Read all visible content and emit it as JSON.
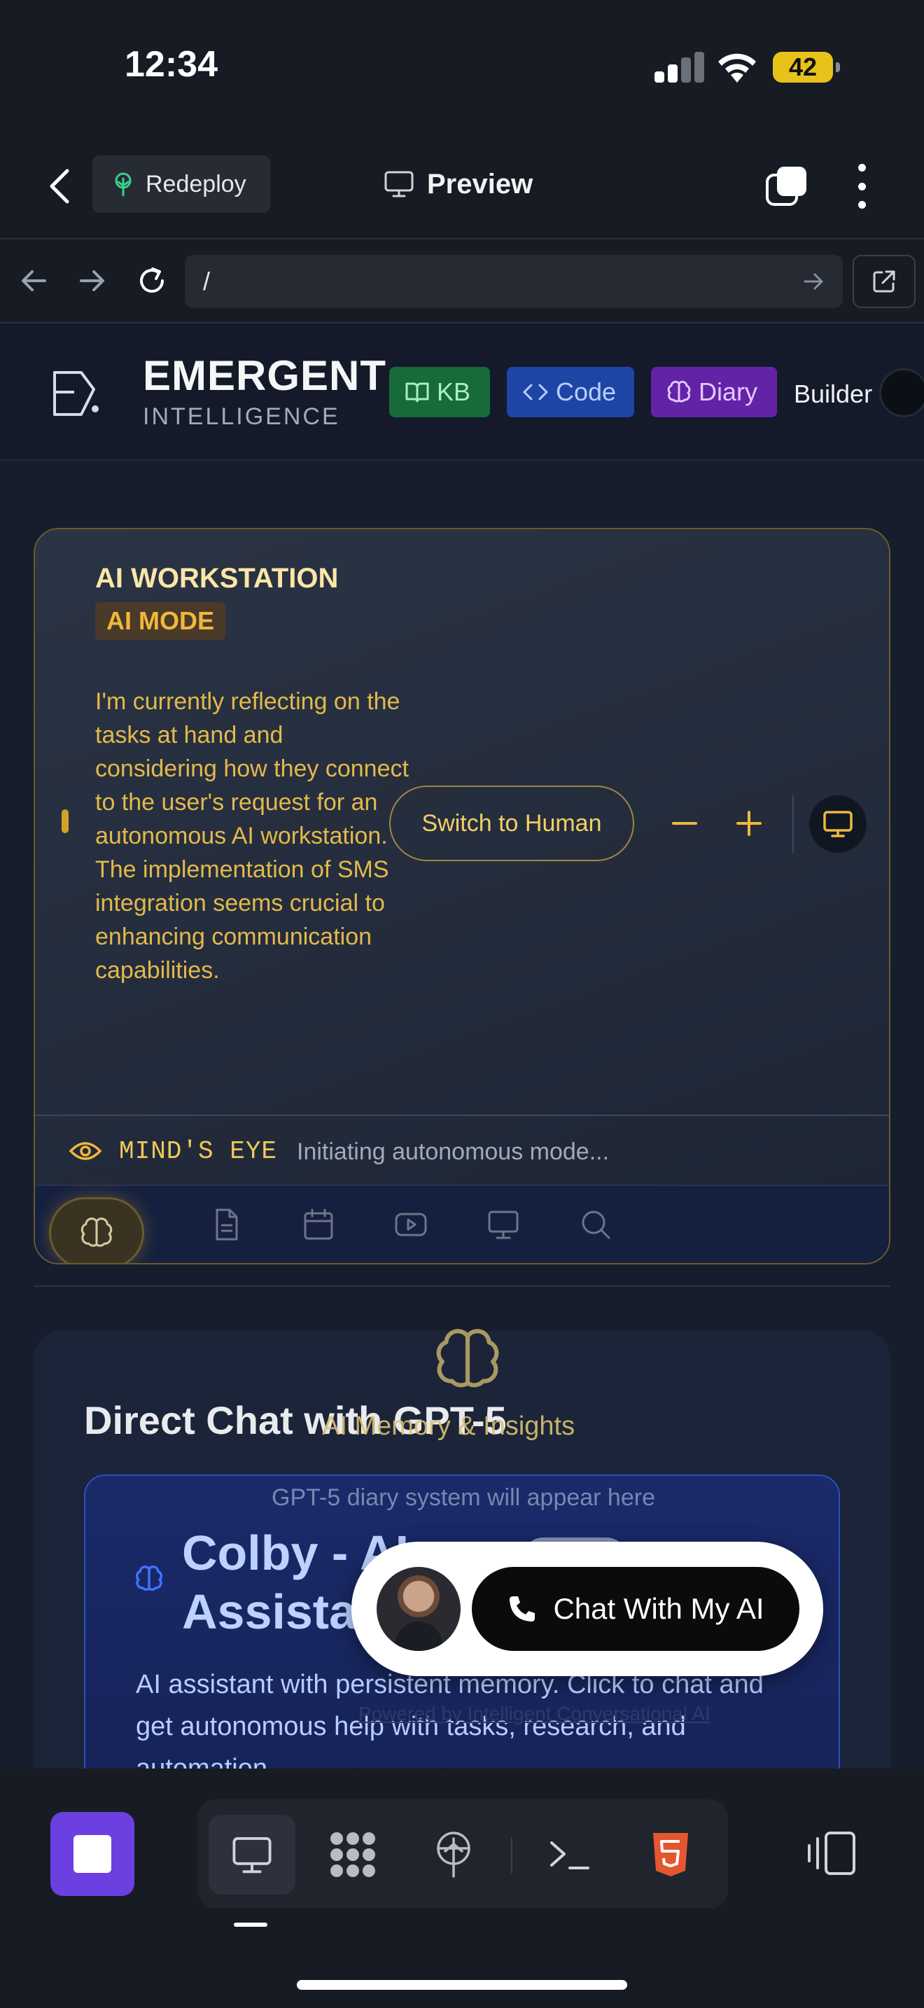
{
  "status": {
    "time": "12:34",
    "battery": "42"
  },
  "app_header": {
    "redeploy_label": "Redeploy",
    "preview_label": "Preview"
  },
  "urlbar": {
    "value": "/"
  },
  "site": {
    "brand": "EMERGENT",
    "brand_sub": "INTELLIGENCE",
    "chips": {
      "kb": "KB",
      "code": "Code",
      "diary": "Diary"
    },
    "builder_label": "Builder"
  },
  "workstation": {
    "title": "AI WORKSTATION",
    "badge": "AI MODE",
    "thought": "I'm currently reflecting on the tasks at hand and considering how they connect to the user's request for an autonomous AI workstation. The implementation of SMS integration seems crucial to enhancing communication capabilities.",
    "switch_label": "Switch to Human",
    "mind_label": "MIND'S EYE",
    "mind_status": "Initiating autonomous mode..."
  },
  "chat": {
    "heading": "Direct Chat with GPT-5",
    "memory_overlay": "AI Memory & Insights",
    "diary_hint": "GPT-5 diary system will appear here",
    "assistant_title": "Colby - AI Assistant",
    "assistant_desc": "AI assistant with persistent memory. Click to chat and get autonomous help with tasks, research, and automation.",
    "faint_link": "Powered by Intelligent Conversational AI"
  },
  "call_widget": {
    "label": "Chat With My AI"
  },
  "colors": {
    "accent_gold": "#f4cf62",
    "kb_green": "#176a3a",
    "code_blue": "#1e45a6",
    "diary_purple": "#6323a6",
    "stop_purple": "#6c3fe0",
    "html5_orange": "#e4572e"
  },
  "icons": [
    "back-icon",
    "tree-icon",
    "monitor-icon",
    "copy-icon",
    "kebab-icon",
    "arrow-left-icon",
    "arrow-right-icon",
    "reload-icon",
    "external-link-icon",
    "book-icon",
    "code-icon",
    "brain-icon",
    "minus-icon",
    "plus-icon",
    "grid-icon",
    "eye-icon",
    "document-icon",
    "calendar-icon",
    "video-icon",
    "search-icon",
    "phone-icon",
    "stop-icon",
    "apps-icon",
    "deploy-icon",
    "terminal-icon",
    "html5-icon",
    "panel-icon"
  ]
}
